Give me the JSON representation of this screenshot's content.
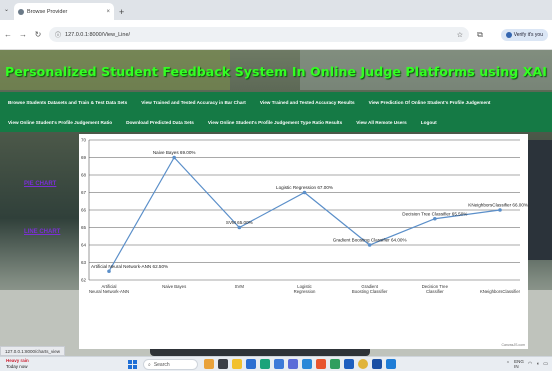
{
  "browser": {
    "tab_title": "Browse Provider",
    "new_tab": "+",
    "url": "127.0.0.1:8000/View_Line/",
    "profile": "Verify it's you"
  },
  "site": {
    "title": "Personalized Student Feedback System In Online Judge Platforms using XAI"
  },
  "menu": {
    "row1": [
      "Browse Students Datasets and Train & Test Data Sets",
      "View Trained and Tested Accuracy in Bar Chart",
      "View Trained and Tested Accuracy Results",
      "View Prediction Of Online Student's Profile Judgement"
    ],
    "row2": [
      "View Online Student's Profile Judgement Ratio",
      "Download Predicted Data Sets",
      "View Online Student's Profile Judgement Type Ratio Results",
      "View All Remote Users",
      "Logout"
    ]
  },
  "side_links": {
    "pie": "PIE CHART",
    "line": "LINE CHART"
  },
  "chart_data": {
    "type": "line",
    "categories": [
      "Artificial Neural Network-ANN",
      "Naive Bayes",
      "SVM",
      "Logistic Regression",
      "Gradient Boosting Classifier",
      "Decision Tree Classifier",
      "KNeighborsClassifier"
    ],
    "values": [
      62.5,
      69.0,
      65.0,
      67.0,
      64.0,
      65.5,
      66.0
    ],
    "data_labels": [
      "Artificial Neural Network-ANN 62.50%",
      "Naive Bayes 69.00%",
      "SVM 65.00%",
      "Logistic Regression 67.00%",
      "Gradient Boosting Classifier 64.00%",
      "Decision Tree Classifier 65.50%",
      "KNeighborsClassifier 66.00%"
    ],
    "tick_labels": [
      "Artificial Neural Network-ANN",
      "Naive Bayes",
      "SVM",
      "Logistic Regression",
      "Gradient Boosting Classifier",
      "Decision Tree Classifier",
      "KNeighborsClassifier"
    ],
    "yticks": [
      "62",
      "63",
      "64",
      "65",
      "66",
      "67",
      "68",
      "69",
      "70"
    ],
    "ylim": [
      62,
      70
    ],
    "grid": true,
    "color": "#5b8fc9",
    "credit": "CanvasJS.com"
  },
  "status_url": "127.0.0.1:8000/charts_view",
  "taskbar": {
    "weather_line1": "Heavy rain",
    "weather_line2": "Today now",
    "search": "Search",
    "lang": "ENG",
    "region": "IN"
  }
}
